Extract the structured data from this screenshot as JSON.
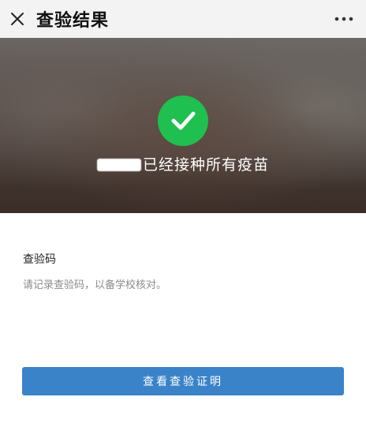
{
  "header": {
    "title": "查验结果",
    "close_icon": "close-icon",
    "more_icon": "more-horizontal-icon"
  },
  "result": {
    "status_icon": "check-circle-icon",
    "message": "已经接种所有疫苗",
    "accent_color": "#1fc04f"
  },
  "verification": {
    "label": "查验码",
    "hint": "请记录查验码，以备学校核对。"
  },
  "actions": {
    "view_certificate_label": "查看查验证明",
    "button_color": "#3b83c9"
  }
}
